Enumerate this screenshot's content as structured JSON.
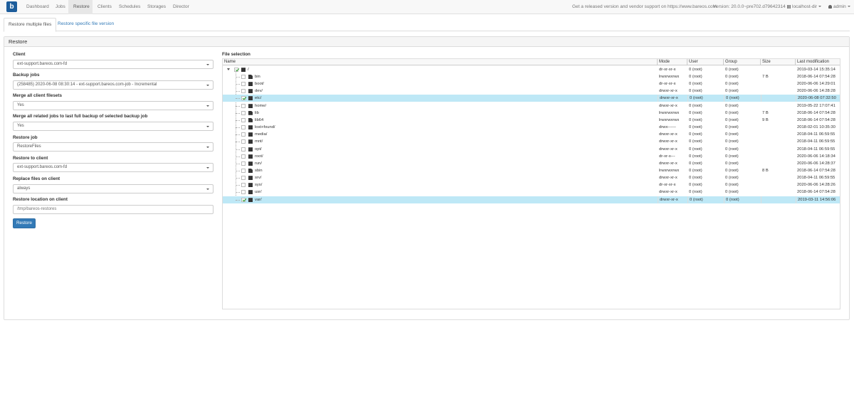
{
  "navbar": {
    "logo": "b",
    "items": [
      {
        "label": "Dashboard",
        "active": false
      },
      {
        "label": "Jobs",
        "active": false
      },
      {
        "label": "Restore",
        "active": true
      },
      {
        "label": "Clients",
        "active": false
      },
      {
        "label": "Schedules",
        "active": false
      },
      {
        "label": "Storages",
        "active": false
      },
      {
        "label": "Director",
        "active": false
      }
    ],
    "support_text": "Get a released version and vendor support on https://www.bareos.com",
    "version": "Version: 20.0.0~pre702.d79642314",
    "director": "localhost-dir",
    "user": "admin"
  },
  "tabs": [
    {
      "label": "Restore multiple files",
      "active": true
    },
    {
      "label": "Restore specific file version",
      "active": false
    }
  ],
  "panel": {
    "title": "Restore",
    "form": {
      "client_label": "Client",
      "client_value": "ext-support.bareos.com-fd",
      "backup_jobs_label": "Backup jobs",
      "backup_jobs_value": "(258485) 2020-06-08 08:30:14 - ext-support.bareos.com-job - Incremental",
      "merge_filesets_label": "Merge all client filesets",
      "merge_filesets_value": "Yes",
      "merge_jobs_label": "Merge all related jobs to last full backup of selected backup job",
      "merge_jobs_value": "Yes",
      "restore_job_label": "Restore job",
      "restore_job_value": "RestoreFiles",
      "restore_to_client_label": "Restore to client",
      "restore_to_client_value": "ext-support.bareos.com-fd",
      "replace_label": "Replace files on client",
      "replace_value": "always",
      "location_label": "Restore location on client",
      "location_value": "/tmp/bareos-restores",
      "restore_button": "Restore"
    },
    "file_selection": {
      "label": "File selection",
      "columns": [
        "Name",
        "Mode",
        "User",
        "Group",
        "Size",
        "Last modification"
      ],
      "root": {
        "name": "/",
        "mode": "dr-xr-xr-x",
        "user": "0 (root)",
        "group": "0 (root)",
        "size": "",
        "modified": "2019-03-14 15:35:14",
        "checked": true
      },
      "rows": [
        {
          "name": "bin",
          "type": "file",
          "mode": "lrwxrwxrwx",
          "user": "0 (root)",
          "group": "0 (root)",
          "size": "7 B",
          "modified": "2018-06-14 07:54:28",
          "checked": false,
          "selected": false
        },
        {
          "name": "boot/",
          "type": "folder",
          "mode": "dr-xr-xr-x",
          "user": "0 (root)",
          "group": "0 (root)",
          "size": "",
          "modified": "2020-06-06 14:29:01",
          "checked": false,
          "selected": false
        },
        {
          "name": "dev/",
          "type": "folder",
          "mode": "drwxr-xr-x",
          "user": "0 (root)",
          "group": "0 (root)",
          "size": "",
          "modified": "2020-06-06 14:28:28",
          "checked": false,
          "selected": false
        },
        {
          "name": "etc/",
          "type": "folder",
          "mode": "drwxr-xr-x",
          "user": "0 (root)",
          "group": "0 (root)",
          "size": "",
          "modified": "2020-06-08 07:32:50",
          "checked": true,
          "selected": true
        },
        {
          "name": "home/",
          "type": "folder",
          "mode": "drwxr-xr-x",
          "user": "0 (root)",
          "group": "0 (root)",
          "size": "",
          "modified": "2019-05-22 17:07:41",
          "checked": false,
          "selected": false
        },
        {
          "name": "lib",
          "type": "file",
          "mode": "lrwxrwxrwx",
          "user": "0 (root)",
          "group": "0 (root)",
          "size": "7 B",
          "modified": "2018-06-14 07:54:28",
          "checked": false,
          "selected": false
        },
        {
          "name": "lib64",
          "type": "file",
          "mode": "lrwxrwxrwx",
          "user": "0 (root)",
          "group": "0 (root)",
          "size": "9 B",
          "modified": "2018-06-14 07:54:28",
          "checked": false,
          "selected": false
        },
        {
          "name": "lost+found/",
          "type": "folder",
          "mode": "drwx------",
          "user": "0 (root)",
          "group": "0 (root)",
          "size": "",
          "modified": "2018-02-01 10:35:30",
          "checked": false,
          "selected": false
        },
        {
          "name": "media/",
          "type": "folder",
          "mode": "drwxr-xr-x",
          "user": "0 (root)",
          "group": "0 (root)",
          "size": "",
          "modified": "2018-04-11 06:59:55",
          "checked": false,
          "selected": false
        },
        {
          "name": "mnt/",
          "type": "folder",
          "mode": "drwxr-xr-x",
          "user": "0 (root)",
          "group": "0 (root)",
          "size": "",
          "modified": "2018-04-11 06:59:55",
          "checked": false,
          "selected": false
        },
        {
          "name": "opt/",
          "type": "folder",
          "mode": "drwxr-xr-x",
          "user": "0 (root)",
          "group": "0 (root)",
          "size": "",
          "modified": "2018-04-11 06:59:55",
          "checked": false,
          "selected": false
        },
        {
          "name": "root/",
          "type": "folder",
          "mode": "dr-xr-x---",
          "user": "0 (root)",
          "group": "0 (root)",
          "size": "",
          "modified": "2020-06-06 14:18:34",
          "checked": false,
          "selected": false
        },
        {
          "name": "run/",
          "type": "folder",
          "mode": "drwxr-xr-x",
          "user": "0 (root)",
          "group": "0 (root)",
          "size": "",
          "modified": "2020-06-06 14:28:37",
          "checked": false,
          "selected": false
        },
        {
          "name": "sbin",
          "type": "file",
          "mode": "lrwxrwxrwx",
          "user": "0 (root)",
          "group": "0 (root)",
          "size": "8 B",
          "modified": "2018-06-14 07:54:28",
          "checked": false,
          "selected": false
        },
        {
          "name": "srv/",
          "type": "folder",
          "mode": "drwxr-xr-x",
          "user": "0 (root)",
          "group": "0 (root)",
          "size": "",
          "modified": "2018-04-11 06:59:55",
          "checked": false,
          "selected": false
        },
        {
          "name": "sys/",
          "type": "folder",
          "mode": "dr-xr-xr-x",
          "user": "0 (root)",
          "group": "0 (root)",
          "size": "",
          "modified": "2020-06-06 14:28:26",
          "checked": false,
          "selected": false
        },
        {
          "name": "usr/",
          "type": "folder",
          "mode": "drwxr-xr-x",
          "user": "0 (root)",
          "group": "0 (root)",
          "size": "",
          "modified": "2018-06-14 07:54:28",
          "checked": false,
          "selected": false
        },
        {
          "name": "var/",
          "type": "folder",
          "mode": "drwxr-xr-x",
          "user": "0 (root)",
          "group": "0 (root)",
          "size": "",
          "modified": "2019-03-11 14:56:06",
          "checked": true,
          "selected": true
        }
      ]
    }
  },
  "icons": {
    "logo": "bareos-logo-icon",
    "director": "grid-icon",
    "user": "user-icon",
    "folder": "folder-icon",
    "file": "file-icon",
    "checkbox": "checkbox-icon"
  },
  "colors": {
    "brand": "#1d5d9b",
    "link": "#337ab7",
    "selected_row": "#bee8f6",
    "check": "#2a9d2a"
  }
}
